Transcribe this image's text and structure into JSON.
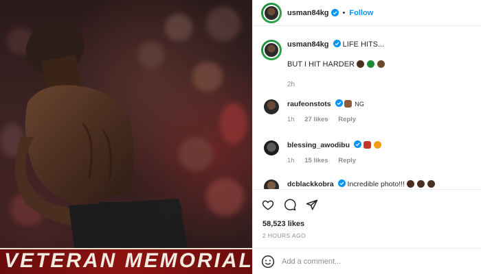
{
  "photo": {
    "banner_text": "VETERAN MEMORIAL A"
  },
  "header": {
    "username": "usman84kg",
    "follow_label": "Follow",
    "separator": "•"
  },
  "caption": {
    "username": "usman84kg",
    "line1": "LIFE HITS...",
    "line2": "BUT I HIT HARDER",
    "time": "2h"
  },
  "comments": [
    {
      "username": "raufeonstots",
      "text": "NG",
      "time": "1h",
      "likes": "27 likes",
      "reply": "Reply"
    },
    {
      "username": "blessing_awodibu",
      "text": "",
      "time": "1h",
      "likes": "15 likes",
      "reply": "Reply"
    },
    {
      "username": "dcblackkobra",
      "text": "Incredible photo!!!",
      "time": "",
      "likes": "",
      "reply": ""
    }
  ],
  "post": {
    "likes": "58,523 likes",
    "time_ago": "2 HOURS AGO",
    "add_comment_placeholder": "Add a comment..."
  },
  "icons": {
    "verified": "verified-badge-icon",
    "like": "heart-icon",
    "comment": "comment-icon",
    "share": "share-icon",
    "emoji": "smile-icon"
  },
  "colors": {
    "accent": "#0095f6",
    "muted": "#8e8e8e",
    "text": "#262626"
  }
}
